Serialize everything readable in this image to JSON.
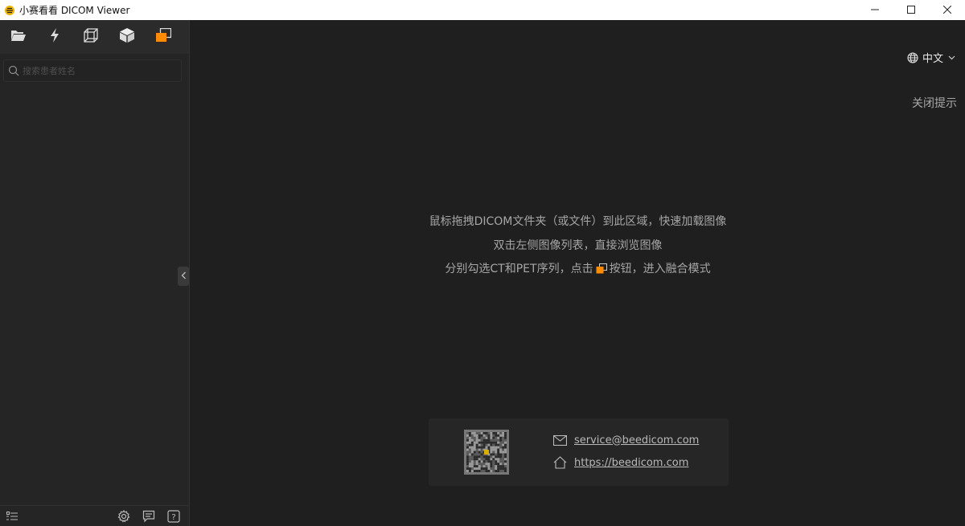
{
  "window": {
    "title": "小赛看看 DICOM Viewer",
    "icons": {
      "app": "bee-logo-icon",
      "minimize": "minimize-icon",
      "maximize": "maximize-icon",
      "close": "close-icon"
    }
  },
  "toolbar": {
    "buttons": [
      {
        "icon": "folder-open-icon"
      },
      {
        "icon": "lightning-icon"
      },
      {
        "icon": "wireframe-cube-icon"
      },
      {
        "icon": "solid-cube-icon"
      },
      {
        "icon": "fusion-icon",
        "color": "#ff8c00"
      }
    ]
  },
  "search": {
    "placeholder": "搜索患者姓名",
    "value": ""
  },
  "sidebar_footer": {
    "icons": [
      "list-icon",
      "settings-icon",
      "feedback-icon",
      "help-icon"
    ]
  },
  "main": {
    "language": {
      "label": "中文"
    },
    "close_tips": "关闭提示",
    "hints": {
      "line1": "鼠标拖拽DICOM文件夹（或文件）到此区域，快速加载图像",
      "line2": "双击左侧图像列表，直接浏览图像",
      "line3_before": "分别勾选CT和PET序列，点击",
      "line3_after": "按钮，进入融合模式"
    },
    "contact": {
      "email": "service@beedicom.com",
      "website": "https://beedicom.com"
    }
  },
  "colors": {
    "accent": "#ff8c00",
    "background": "#1f1f1f",
    "sidebar": "#252525"
  }
}
